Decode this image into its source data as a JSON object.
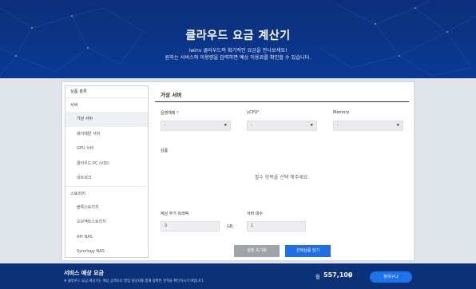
{
  "hero": {
    "title": "클라우드 요금 계산기",
    "subtitle1": "iwinv 클라우드의 획기적인 요금을 만나보세요!",
    "subtitle2": "원하는 서비스와 이용량을 입력하면 예상 이용료를 확인할 수 있습니다."
  },
  "sidebar": {
    "header": "상품 분류",
    "group_server": "서버",
    "items_server": [
      "가상 서버",
      "베어메탈 서버",
      "GPU 서버",
      "클라우드 PC (VDI)",
      "네트워크"
    ],
    "group_storage": "스토리지",
    "items_storage": [
      "블록스토리지",
      "오브젝트스토리지",
      "API NAS",
      "Synology NAS"
    ]
  },
  "content": {
    "title": "가상 서버",
    "os_label": "운영체제",
    "vcpu_label": "vCPU",
    "memory_label": "Memory",
    "required_mark": "*",
    "select_value": "-",
    "product_label": "상품",
    "product_message": "필수 항목을 선택 해주세요.",
    "traffic_label": "예상 추가 트래픽",
    "traffic_value": "0",
    "traffic_unit": "GB",
    "server_count_label": "서버 대수",
    "server_count_value": "1",
    "reset_button": "설정 초기화",
    "cart_button": "선택상품 담기"
  },
  "footer": {
    "title": "서비스 예상 요금",
    "note": "※ 클라우드 요금 계산기는 예상 금액으로 영업 담당자를 통해 정확한 견적을 확인하시기 바랍니다.",
    "month": "월",
    "price": "557,100",
    "currency": "원",
    "cart_link": "장바구니"
  },
  "colors": {
    "hero_bg": "#0a3a95",
    "footer_bg": "#0b3278",
    "primary_button": "#1e6ee8",
    "reset_button": "#a0a3a8",
    "required": "#dd3333"
  }
}
